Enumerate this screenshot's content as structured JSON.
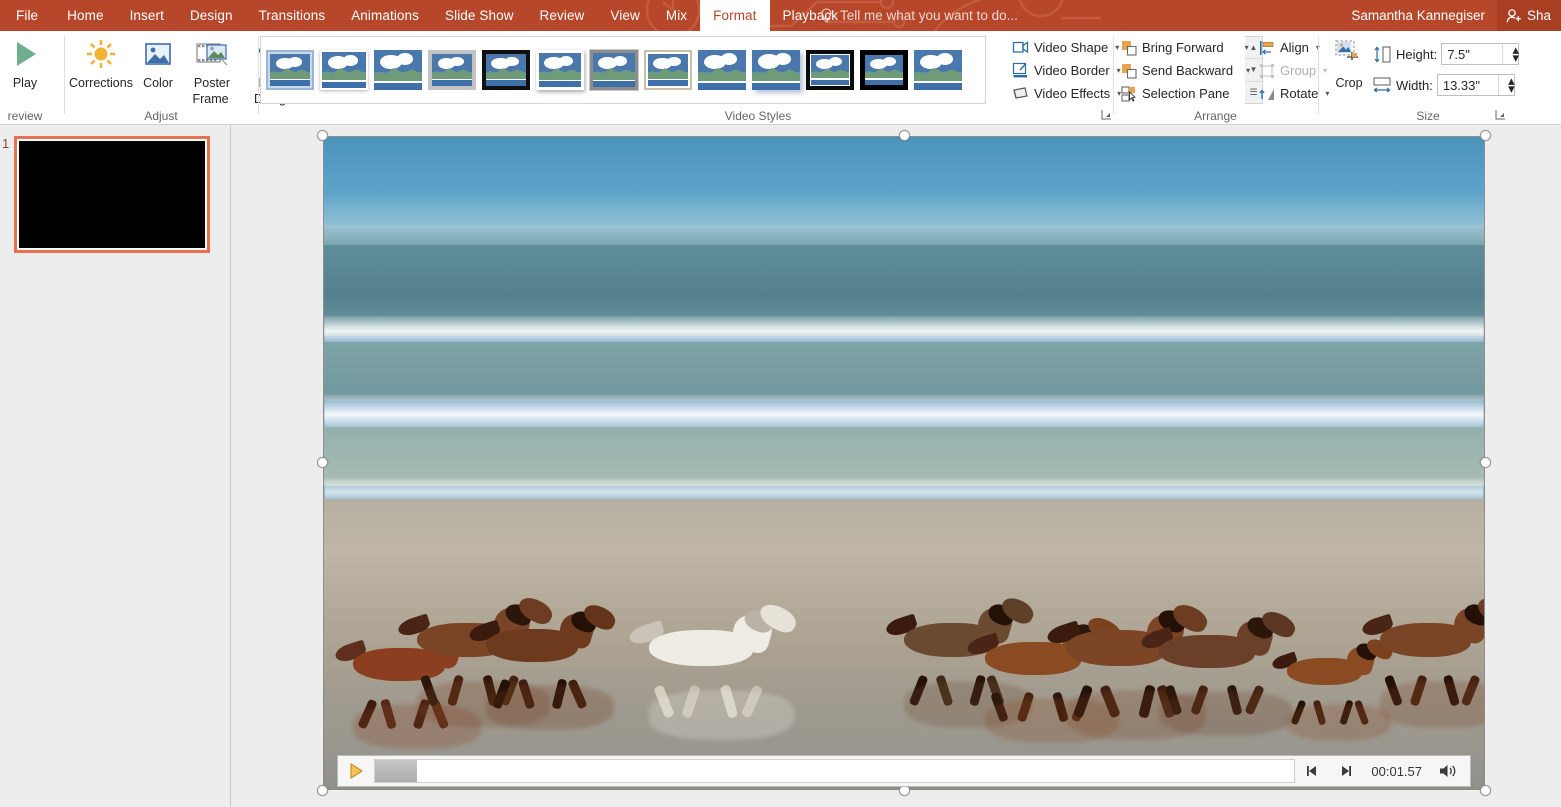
{
  "titlebar": {
    "tabs": [
      {
        "label": "File",
        "active": false
      },
      {
        "label": "Home",
        "active": false
      },
      {
        "label": "Insert",
        "active": false
      },
      {
        "label": "Design",
        "active": false
      },
      {
        "label": "Transitions",
        "active": false
      },
      {
        "label": "Animations",
        "active": false
      },
      {
        "label": "Slide Show",
        "active": false
      },
      {
        "label": "Review",
        "active": false
      },
      {
        "label": "View",
        "active": false
      },
      {
        "label": "Mix",
        "active": false
      },
      {
        "label": "Format",
        "active": true
      },
      {
        "label": "Playback",
        "active": false
      }
    ],
    "tellme_placeholder": "Tell me what you want to do...",
    "username": "Samantha Kannegiser",
    "share_label": "Sha",
    "accent_color": "#b7472a",
    "share_bg": "#a83e22"
  },
  "ribbon": {
    "preview_group": {
      "label": "review",
      "play_label": "Play"
    },
    "adjust_group": {
      "label": "Adjust",
      "items": [
        {
          "label": "Corrections",
          "caret": "▾"
        },
        {
          "label": "Color",
          "caret": "▾"
        },
        {
          "label": "Poster\nFrame",
          "caret": "▾"
        },
        {
          "label": "Reset\nDesign",
          "caret": "▾"
        }
      ],
      "corrections_label": "Corrections",
      "color_label": "Color",
      "poster_frame_line1": "Poster",
      "poster_frame_line2": "Frame",
      "reset_design_line1": "Reset",
      "reset_design_line2": "Design"
    },
    "video_styles_group": {
      "label": "Video Styles",
      "styles": [
        {
          "name": "style-1",
          "frame": "inset-border",
          "selected": false
        },
        {
          "name": "style-2",
          "frame": "blue-thin",
          "selected": false
        },
        {
          "name": "style-3",
          "frame": "none",
          "selected": false
        },
        {
          "name": "style-4",
          "frame": "grey-thick",
          "selected": false
        },
        {
          "name": "style-5",
          "frame": "black-thick",
          "selected": true
        },
        {
          "name": "style-6",
          "frame": "white-shadow",
          "selected": false
        },
        {
          "name": "style-7",
          "frame": "grey-double",
          "selected": false
        },
        {
          "name": "style-8",
          "frame": "tan-thin",
          "selected": false
        },
        {
          "name": "style-9",
          "frame": "none-2",
          "selected": false
        },
        {
          "name": "style-10",
          "frame": "soft-shadow",
          "selected": false
        },
        {
          "name": "style-11",
          "frame": "black-inset",
          "selected": true
        },
        {
          "name": "style-12",
          "frame": "black-heavy",
          "selected": true
        },
        {
          "name": "style-13",
          "frame": "plain",
          "selected": false
        }
      ],
      "scroll_up": "▲",
      "scroll_down": "▼",
      "scroll_more": "☰",
      "video_shape_label": "Video Shape",
      "video_border_label": "Video Border",
      "video_effects_label": "Video Effects",
      "caret": "▾"
    },
    "arrange_group": {
      "label": "Arrange",
      "bring_forward_label": "Bring Forward",
      "send_backward_label": "Send Backward",
      "selection_pane_label": "Selection Pane",
      "align_label": "Align",
      "group_label": "Group",
      "group_disabled": true,
      "rotate_label": "Rotate",
      "caret": "▾"
    },
    "size_group": {
      "label": "Size",
      "crop_label": "Crop",
      "height_label": "Height:",
      "height_value": "7.5\"",
      "width_label": "Width:",
      "width_value": "13.33\"",
      "spin_up": "▴",
      "spin_down": "▾"
    }
  },
  "slide_panel": {
    "slides": [
      {
        "number": "1",
        "selected": true,
        "background": "#000000"
      }
    ],
    "selection_color": "#e8714f"
  },
  "media_controls": {
    "play_label": "▶",
    "step_back_label": "⏮",
    "step_forward_label": "⏭",
    "volume_label": "🔊",
    "time": "00:01.57",
    "progress_percent": 4.6
  },
  "video_object": {
    "selected": true,
    "handle_count": 8,
    "description": "beach-horses-video"
  }
}
